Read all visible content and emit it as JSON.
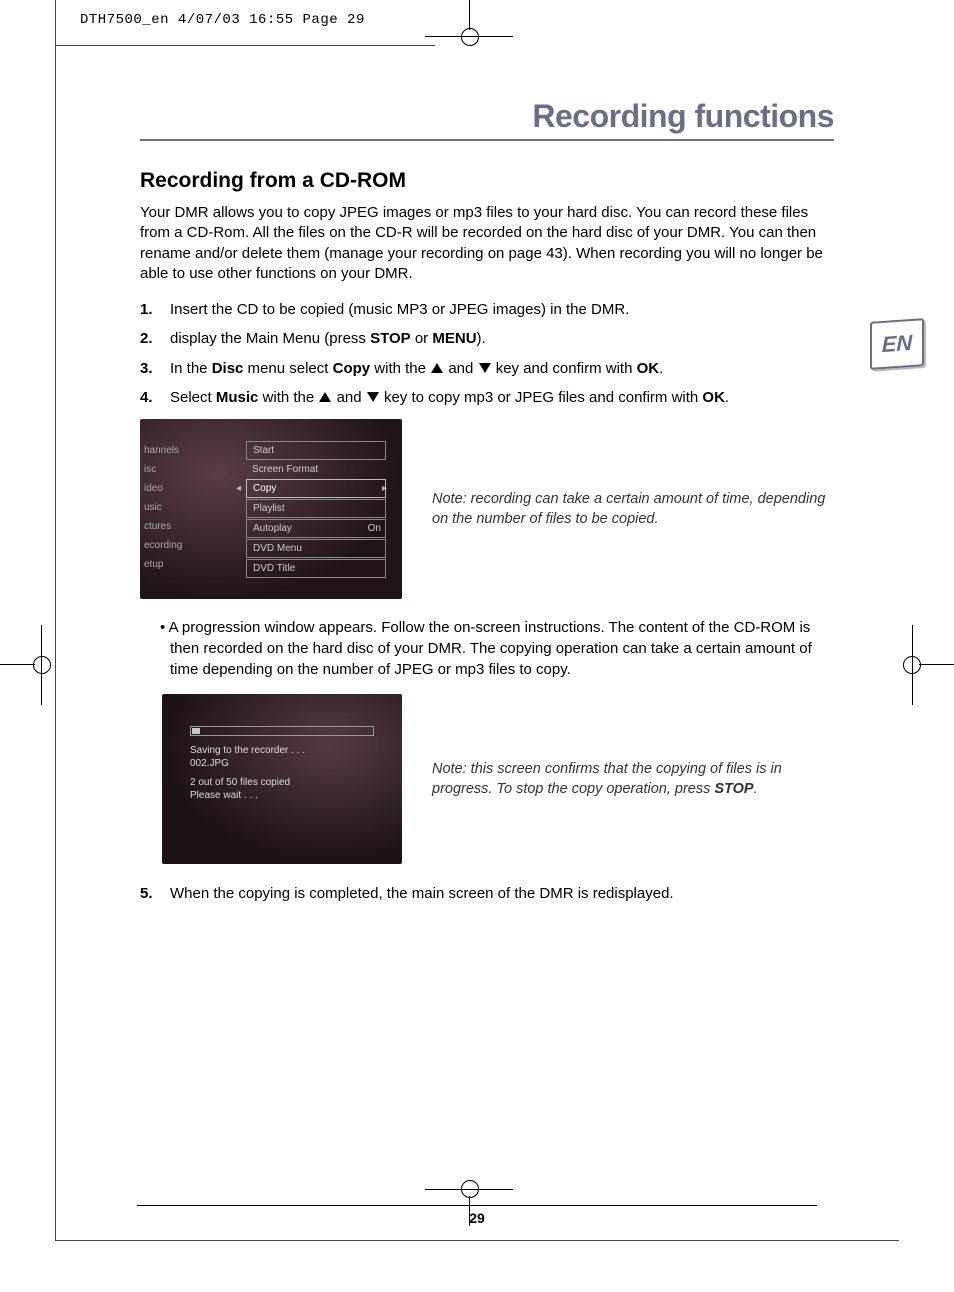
{
  "meta_header": "DTH7500_en  4/07/03  16:55  Page 29",
  "page_title": "Recording functions",
  "lang_badge": "EN",
  "section_title": "Recording from a CD-ROM",
  "intro": "Your DMR allows you to copy JPEG images or mp3 files to your hard disc. You can record these files from a CD-Rom. All the files on the CD-R will be recorded on the hard disc of your DMR. You can then rename and/or delete them (manage your recording on page 43). When recording you will no longer be able to use other functions on your DMR.",
  "step1": "Insert the CD to be copied (music MP3 or JPEG images) in the DMR.",
  "step2_a": "display the Main Menu (press ",
  "step2_b": "STOP",
  "step2_c": " or ",
  "step2_d": "MENU",
  "step2_e": ").",
  "step3_a": "In the ",
  "step3_b": "Disc",
  "step3_c": " menu select ",
  "step3_d": "Copy",
  "step3_e": " with the ",
  "step3_f": " and ",
  "step3_g": " key and confirm with ",
  "step3_h": "OK",
  "step3_i": ".",
  "step4_a": "Select ",
  "step4_b": "Music",
  "step4_c": " with the ",
  "step4_d": " and ",
  "step4_e": " key to copy mp3 or JPEG files and confirm with ",
  "step4_f": "OK",
  "step4_g": ".",
  "menu_left": [
    "hannels",
    "isc",
    "ideo",
    "usic",
    "ctures",
    "ecording",
    "etup"
  ],
  "menu_right": [
    {
      "label": "Start",
      "box": true
    },
    {
      "label": "Screen Format"
    },
    {
      "label": "Copy",
      "hl": true
    },
    {
      "label": "Playlist",
      "box": true
    },
    {
      "label": "Autoplay",
      "box": true,
      "val": "On"
    },
    {
      "label": "DVD Menu",
      "box": true
    },
    {
      "label": "DVD Title",
      "box": true
    }
  ],
  "note1": "Note: recording can take a certain amount of time, depending on the number of files to be copied.",
  "bullet": "• A progression window appears. Follow the on-screen instructions. The content of the CD-ROM is then recorded on the hard disc of your DMR. The copying operation can take a certain amount of time depending on the number of JPEG or mp3 files to copy.",
  "progress": {
    "l1": "Saving to the recorder . . .",
    "l2": "002.JPG",
    "l3": "2 out of 50 files copied",
    "l4": "Please wait . . ."
  },
  "note2_a": "Note: this screen confirms that the copying of files is in progress. To stop the copy operation, press ",
  "note2_b": "STOP",
  "note2_c": ".",
  "step5": "When the copying is completed, the main screen of the DMR is redisplayed.",
  "page_number": "29"
}
